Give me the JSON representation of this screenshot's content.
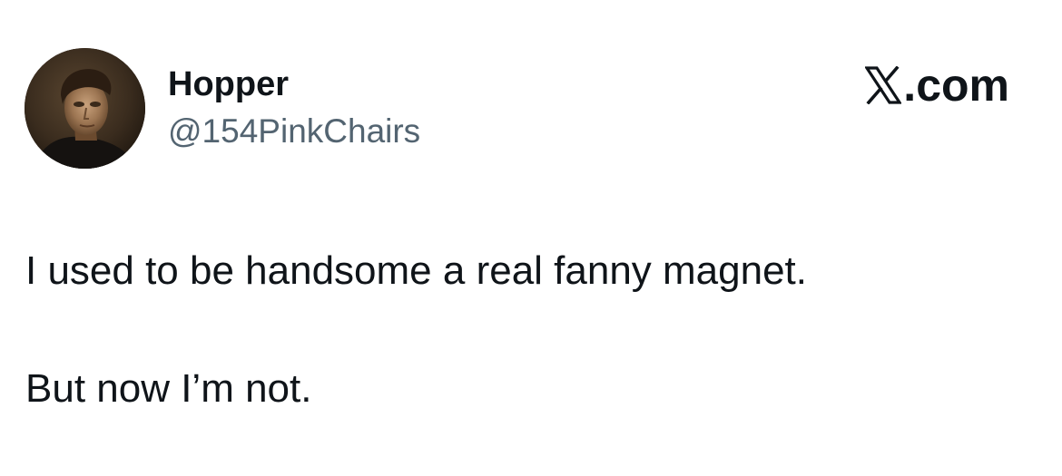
{
  "tweet": {
    "author": {
      "display_name": "Hopper",
      "handle": "@154PinkChairs",
      "avatar": "portrait-painting-avatar"
    },
    "brand": {
      "icon": "x-logo-icon",
      "label": ".com"
    },
    "text_lines": [
      "I used to be handsome a real fanny magnet.",
      "But now I’m not."
    ]
  },
  "colors": {
    "text_primary": "#0f1419",
    "text_secondary": "#536471",
    "background": "#ffffff"
  }
}
